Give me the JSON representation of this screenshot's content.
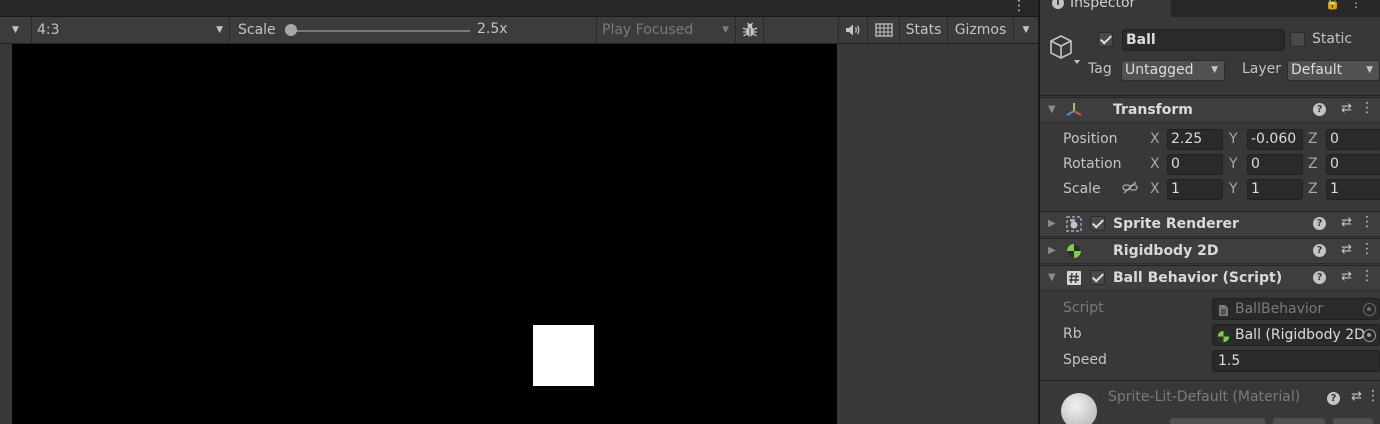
{
  "game_view": {
    "aspect": "4:3",
    "scale_label": "Scale",
    "scale_value": "2.5x",
    "scale_fraction": 0.0,
    "play_mode": "Play Focused",
    "stats_label": "Stats",
    "gizmos_label": "Gizmos"
  },
  "inspector": {
    "tab_title": "Inspector",
    "gameobject": {
      "name": "Ball",
      "active": true,
      "static_label": "Static",
      "static_checked": false,
      "tag_label": "Tag",
      "tag_value": "Untagged",
      "layer_label": "Layer",
      "layer_value": "Default"
    },
    "transform": {
      "title": "Transform",
      "position_label": "Position",
      "rotation_label": "Rotation",
      "scale_label": "Scale",
      "axis_x": "X",
      "axis_y": "Y",
      "axis_z": "Z",
      "position": {
        "x": "2.25",
        "y": "-0.060",
        "z": "0"
      },
      "rotation": {
        "x": "0",
        "y": "0",
        "z": "0"
      },
      "scale": {
        "x": "1",
        "y": "1",
        "z": "1"
      }
    },
    "sprite_renderer": {
      "title": "Sprite Renderer",
      "enabled": true
    },
    "rigidbody2d": {
      "title": "Rigidbody 2D"
    },
    "ball_behavior": {
      "title": "Ball Behavior (Script)",
      "enabled": true,
      "script_label": "Script",
      "script_value": "BallBehavior",
      "rb_label": "Rb",
      "rb_value": "Ball (Rigidbody 2D",
      "speed_label": "Speed",
      "speed_value": "1.5"
    },
    "material": {
      "title": "Sprite-Lit-Default (Material)"
    }
  },
  "colors": {
    "panel_bg": "#383838",
    "toolbar_bg": "#3c3c3c",
    "field_bg": "#2a2a2a",
    "rigidbody_icon": "#7bd23f",
    "transform_x": "#e0524a",
    "transform_y": "#8ed43e",
    "transform_z": "#4a8fe0"
  },
  "icons": {
    "bug": "bug-icon",
    "audio": "audio-icon",
    "grid": "grid-icon",
    "gameobject": "cube-icon",
    "transform": "transform-axes-icon",
    "sprite": "sprite-renderer-icon",
    "rigidbody": "rigidbody-icon",
    "script": "script-icon",
    "link": "constrain-proportions-icon"
  }
}
